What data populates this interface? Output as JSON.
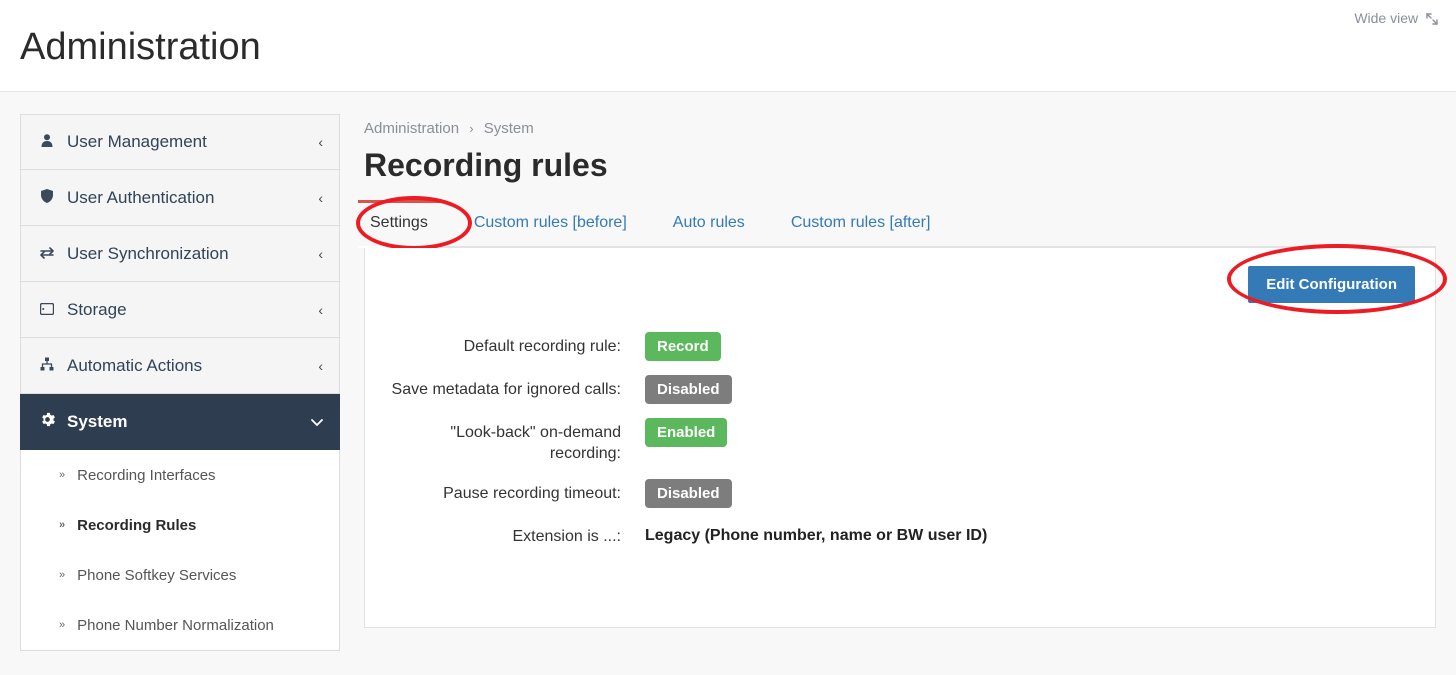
{
  "header": {
    "title": "Administration",
    "wide_view": "Wide view"
  },
  "sidebar": {
    "items": [
      {
        "label": "User Management"
      },
      {
        "label": "User Authentication"
      },
      {
        "label": "User Synchronization"
      },
      {
        "label": "Storage"
      },
      {
        "label": "Automatic Actions"
      },
      {
        "label": "System"
      }
    ],
    "sub_items": [
      {
        "label": "Recording Interfaces"
      },
      {
        "label": "Recording Rules"
      },
      {
        "label": "Phone Softkey Services"
      },
      {
        "label": "Phone Number Normalization"
      }
    ]
  },
  "breadcrumb": {
    "root": "Administration",
    "leaf": "System"
  },
  "main": {
    "heading": "Recording rules",
    "tabs": {
      "settings": "Settings",
      "custom_before": "Custom rules [before]",
      "auto_rules": "Auto rules",
      "custom_after": "Custom rules [after]"
    },
    "edit_button": "Edit Configuration",
    "rows": {
      "r1": {
        "label": "Default recording rule:",
        "value": "Record"
      },
      "r2": {
        "label": "Save metadata for ignored calls:",
        "value": "Disabled"
      },
      "r3": {
        "label": "\"Look-back\" on-demand recording:",
        "value": "Enabled"
      },
      "r4": {
        "label": "Pause recording timeout:",
        "value": "Disabled"
      },
      "r5": {
        "label": "Extension is ...:",
        "value": "Legacy (Phone number, name or BW user ID)"
      }
    }
  }
}
